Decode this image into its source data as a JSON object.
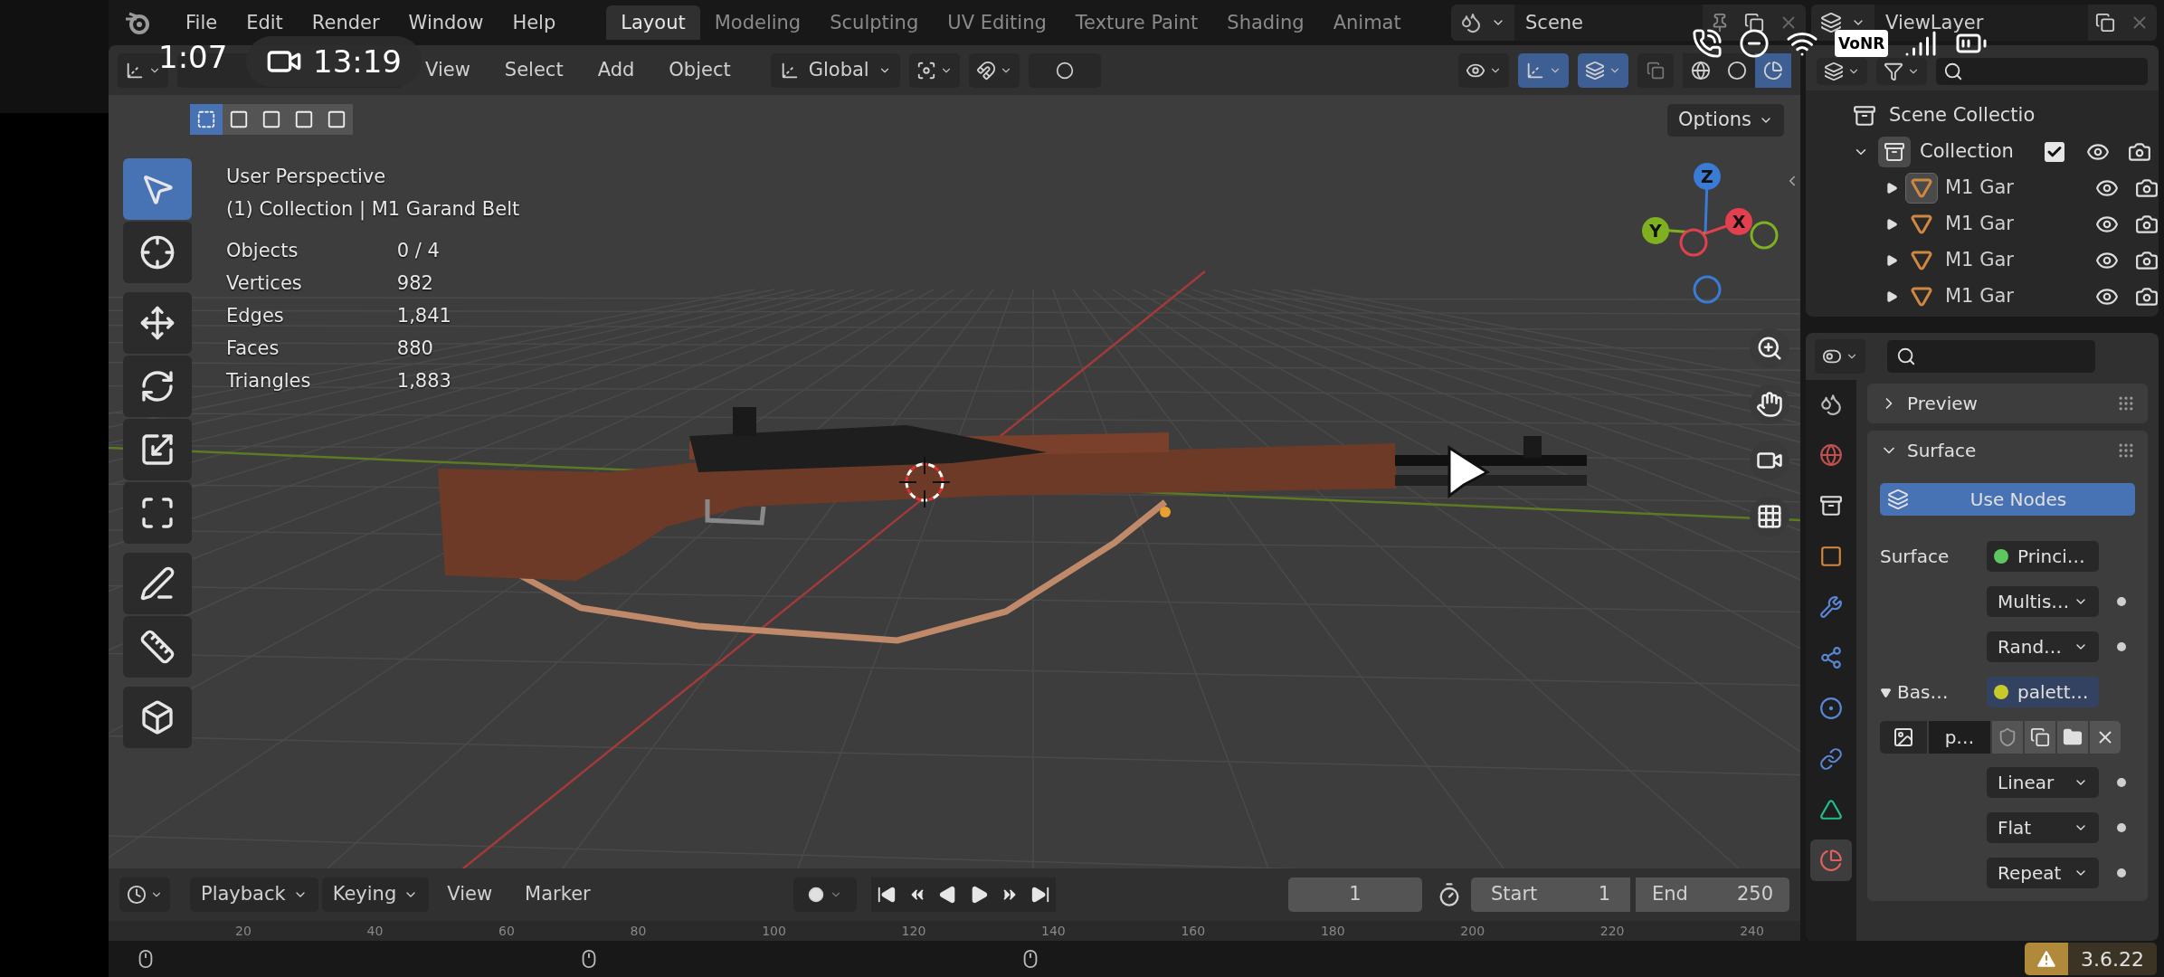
{
  "phone_overlay": {
    "clock": "1:07",
    "recording_time": "13:19",
    "network_badge": "VoNR"
  },
  "menu": [
    "File",
    "Edit",
    "Render",
    "Window",
    "Help"
  ],
  "workspaces": [
    {
      "label": "Layout",
      "selected": true
    },
    {
      "label": "Modeling",
      "selected": false
    },
    {
      "label": "Sculpting",
      "selected": false
    },
    {
      "label": "UV Editing",
      "selected": false
    },
    {
      "label": "Texture Paint",
      "selected": false
    },
    {
      "label": "Shading",
      "selected": false
    },
    {
      "label": "Animat",
      "selected": false
    }
  ],
  "scene": {
    "name": "Scene"
  },
  "view_layer": {
    "name": "ViewLayer"
  },
  "viewport": {
    "menus": [
      "View",
      "Select",
      "Add",
      "Object"
    ],
    "orientation": "Global",
    "select_modes": [
      {
        "selected": true
      },
      {
        "selected": false
      },
      {
        "selected": false
      },
      {
        "selected": false
      },
      {
        "selected": false
      }
    ],
    "gizmos_on": true,
    "overlays_on": true,
    "shading_modes": [
      {
        "kind": "wireframe",
        "selected": false
      },
      {
        "kind": "solid",
        "selected": false
      },
      {
        "kind": "material",
        "selected": true
      }
    ],
    "options": "Options",
    "view_name": "User Perspective",
    "context": "(1) Collection | M1 Garand Belt",
    "stats": [
      {
        "label": "Objects",
        "value": "0 / 4"
      },
      {
        "label": "Vertices",
        "value": "982"
      },
      {
        "label": "Edges",
        "value": "1,841"
      },
      {
        "label": "Faces",
        "value": "880"
      },
      {
        "label": "Triangles",
        "value": "1,883"
      }
    ],
    "tool_groups": [
      [
        {
          "kind": "select",
          "selected": true
        },
        {
          "kind": "cursor",
          "selected": false
        }
      ],
      [
        {
          "kind": "move",
          "selected": false
        },
        {
          "kind": "rotate",
          "selected": false
        },
        {
          "kind": "scale",
          "selected": false
        },
        {
          "kind": "transform",
          "selected": false
        }
      ],
      [
        {
          "kind": "annotate",
          "selected": false
        },
        {
          "kind": "measure",
          "selected": false
        }
      ],
      [
        {
          "kind": "add_cube",
          "selected": false
        }
      ]
    ],
    "gizmo_axes": [
      {
        "label": "X",
        "color": "#e2404f"
      },
      {
        "label": "Y",
        "color": "#7fb020"
      },
      {
        "label": "Z",
        "color": "#3a7bd5"
      }
    ]
  },
  "outliner": {
    "root": "Scene Collectio",
    "collection": {
      "label": "Collection",
      "expanded": true,
      "checked": true,
      "children": [
        {
          "label": "M1 Gar",
          "selected": true
        },
        {
          "label": "M1 Gar",
          "selected": false
        },
        {
          "label": "M1 Gar",
          "selected": false
        },
        {
          "label": "M1 Gar",
          "selected": false
        }
      ]
    }
  },
  "properties": {
    "tabs": [
      {
        "kind": "scene",
        "selected": false
      },
      {
        "kind": "world",
        "selected": false
      },
      {
        "kind": "collection",
        "selected": false
      },
      {
        "kind": "object",
        "selected": false
      },
      {
        "kind": "modifiers",
        "selected": false
      },
      {
        "kind": "particles",
        "selected": false
      },
      {
        "kind": "physics",
        "selected": false
      },
      {
        "kind": "constraints",
        "selected": false
      },
      {
        "kind": "data",
        "selected": false
      },
      {
        "kind": "material",
        "selected": true
      }
    ],
    "panels": [
      {
        "title": "Preview",
        "expanded": false
      },
      {
        "title": "Surface",
        "expanded": true
      }
    ],
    "use_nodes": {
      "label": "Use Nodes",
      "on": true
    },
    "fields": [
      {
        "kind": "socket",
        "label": "Surface",
        "value": "Princi…",
        "color": "#5fc75f"
      },
      {
        "kind": "dropdown",
        "value": "Multis…"
      },
      {
        "kind": "dropdown",
        "value": "Rand…"
      },
      {
        "kind": "socket_group",
        "label": "Bas…",
        "expanded": true,
        "value": "palett…",
        "color": "#c9c92a",
        "selected": true
      },
      {
        "kind": "image",
        "value": "p…"
      },
      {
        "kind": "dropdown",
        "value": "Linear"
      },
      {
        "kind": "dropdown",
        "value": "Flat"
      },
      {
        "kind": "dropdown",
        "value": "Repeat"
      }
    ]
  },
  "timeline": {
    "menus": [
      {
        "label": "Playback",
        "dropdown": true
      },
      {
        "label": "Keying",
        "dropdown": true
      },
      {
        "label": "View",
        "dropdown": false
      },
      {
        "label": "Marker",
        "dropdown": false
      }
    ],
    "current_frame": "1",
    "start_label": "Start",
    "start": "1",
    "end_label": "End",
    "end": "250",
    "ruler": [
      "20",
      "40",
      "60",
      "80",
      "100",
      "120",
      "140",
      "160",
      "180",
      "200",
      "220",
      "240"
    ]
  },
  "status": {
    "version": "3.6.22"
  }
}
